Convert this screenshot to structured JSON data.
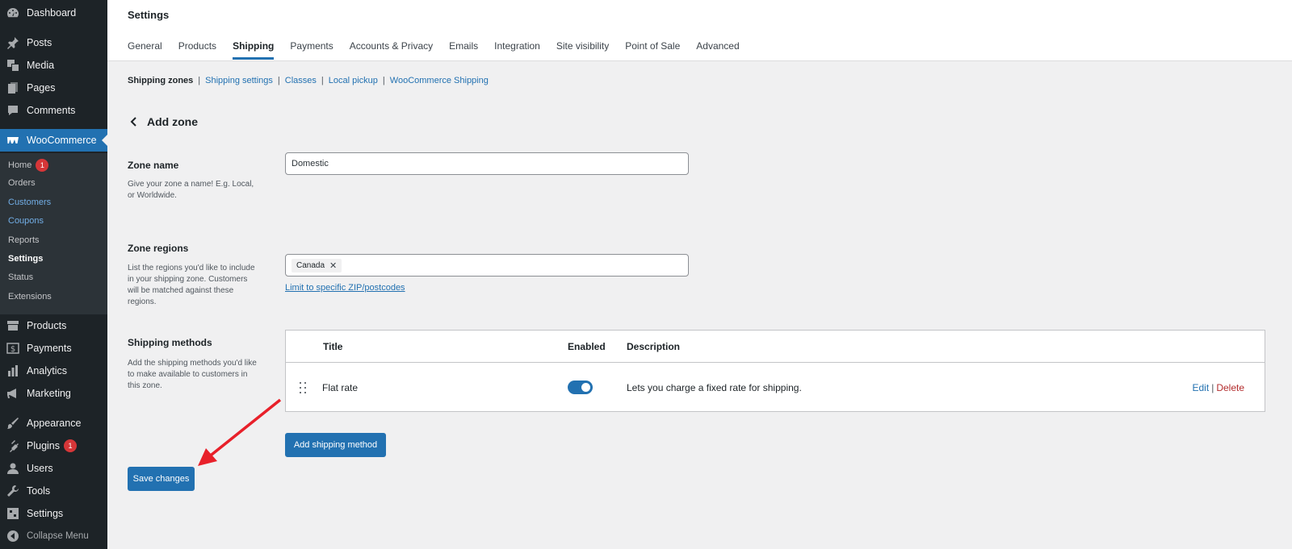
{
  "sidebar": {
    "items": [
      {
        "label": "Dashboard",
        "icon": "dashboard-icon"
      },
      {
        "label": "Posts",
        "icon": "pin-icon"
      },
      {
        "label": "Media",
        "icon": "media-icon"
      },
      {
        "label": "Pages",
        "icon": "pages-icon"
      },
      {
        "label": "Comments",
        "icon": "comment-icon"
      },
      {
        "label": "WooCommerce",
        "icon": "woocommerce-icon"
      },
      {
        "label": "Products",
        "icon": "archive-icon"
      },
      {
        "label": "Payments",
        "icon": "dollar-icon"
      },
      {
        "label": "Analytics",
        "icon": "chart-bar-icon"
      },
      {
        "label": "Marketing",
        "icon": "megaphone-icon"
      },
      {
        "label": "Appearance",
        "icon": "paintbrush-icon"
      },
      {
        "label": "Plugins",
        "icon": "plugin-icon",
        "badge": "1"
      },
      {
        "label": "Users",
        "icon": "user-icon"
      },
      {
        "label": "Tools",
        "icon": "wrench-icon"
      },
      {
        "label": "Settings",
        "icon": "settings-icon"
      }
    ],
    "submenu": [
      {
        "label": "Home",
        "badge": "1"
      },
      {
        "label": "Orders"
      },
      {
        "label": "Customers"
      },
      {
        "label": "Coupons"
      },
      {
        "label": "Reports"
      },
      {
        "label": "Settings"
      },
      {
        "label": "Status"
      },
      {
        "label": "Extensions"
      }
    ],
    "collapse_label": "Collapse Menu",
    "active_color": "#2271b1",
    "background": "#1d2327"
  },
  "header": {
    "title": "Settings",
    "tabs": [
      {
        "label": "General"
      },
      {
        "label": "Products"
      },
      {
        "label": "Shipping",
        "active": true
      },
      {
        "label": "Payments"
      },
      {
        "label": "Accounts & Privacy"
      },
      {
        "label": "Emails"
      },
      {
        "label": "Integration"
      },
      {
        "label": "Site visibility"
      },
      {
        "label": "Point of Sale"
      },
      {
        "label": "Advanced"
      }
    ]
  },
  "subnav": {
    "current": "Shipping zones",
    "links": [
      "Shipping settings",
      "Classes",
      "Local pickup",
      "WooCommerce Shipping"
    ]
  },
  "zone": {
    "back_title": "Add zone",
    "name_label": "Zone name",
    "name_desc": "Give your zone a name! E.g. Local, or Worldwide.",
    "name_value": "Domestic",
    "regions_label": "Zone regions",
    "regions_desc": "List the regions you'd like to include in your shipping zone. Customers will be matched against these regions.",
    "region_chip": "Canada",
    "limit_link": "Limit to specific ZIP/postcodes",
    "methods_label": "Shipping methods",
    "methods_desc": "Add the shipping methods you'd like to make available to customers in this zone."
  },
  "methods_table": {
    "headers": {
      "title": "Title",
      "enabled": "Enabled",
      "description": "Description"
    },
    "rows": [
      {
        "title": "Flat rate",
        "enabled": true,
        "description": "Lets you charge a fixed rate for shipping.",
        "edit": "Edit",
        "delete": "Delete"
      }
    ]
  },
  "buttons": {
    "add_method": "Add shipping method",
    "save": "Save changes"
  },
  "annotation": {
    "arrow_color": "#e8202a"
  }
}
